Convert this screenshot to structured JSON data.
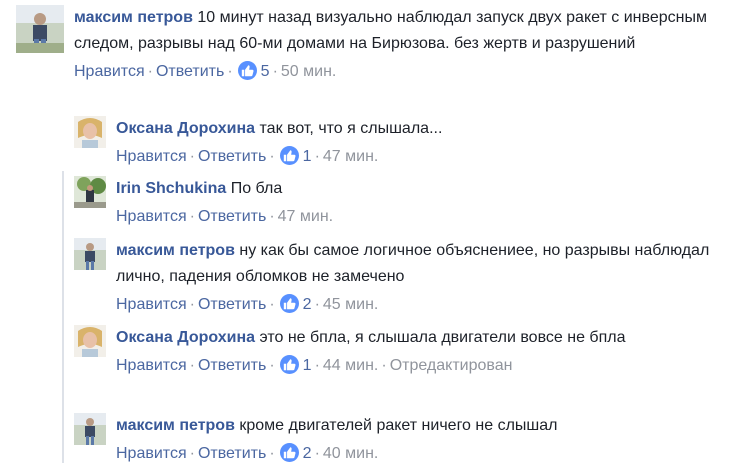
{
  "comments": [
    {
      "author": "максим петров",
      "text": "10 минут назад визуально наблюдал запуск двух ракет с инверсным следом, разрывы над 60-ми домами на Бирюзова. без жертв и разрушений",
      "like_label": "Нравится",
      "reply_label": "Ответить",
      "likes": "5",
      "time": "50 мин.",
      "edited": ""
    },
    {
      "author": "Оксана Дорохина",
      "text": "так вот, что я слышала...",
      "like_label": "Нравится",
      "reply_label": "Ответить",
      "likes": "1",
      "time": "47 мин.",
      "edited": ""
    },
    {
      "author": "Irin Shchukina",
      "text": "По бла",
      "like_label": "Нравится",
      "reply_label": "Ответить",
      "likes": "",
      "time": "47 мин.",
      "edited": ""
    },
    {
      "author": "максим петров",
      "text": "ну как бы самое логичное объяснениее, но разрывы наблюдал лично, падения обломков не замечено",
      "like_label": "Нравится",
      "reply_label": "Ответить",
      "likes": "2",
      "time": "45 мин.",
      "edited": ""
    },
    {
      "author": "Оксана Дорохина",
      "text": "это не бпла, я слышала двигатели вовсе не бпла",
      "like_label": "Нравится",
      "reply_label": "Ответить",
      "likes": "1",
      "time": "44 мин.",
      "edited": "Отредактирован"
    },
    {
      "author": "максим петров",
      "text": "кроме двигателей ракет ничего не слышал",
      "like_label": "Нравится",
      "reply_label": "Ответить",
      "likes": "2",
      "time": "40 мин.",
      "edited": ""
    }
  ],
  "colors": {
    "author": "#385898",
    "link": "#4b67a1",
    "meta": "#90949c",
    "like_badge": "#5890ff",
    "text": "#1d2129"
  },
  "icons": {
    "like": "thumbs-up-icon"
  }
}
